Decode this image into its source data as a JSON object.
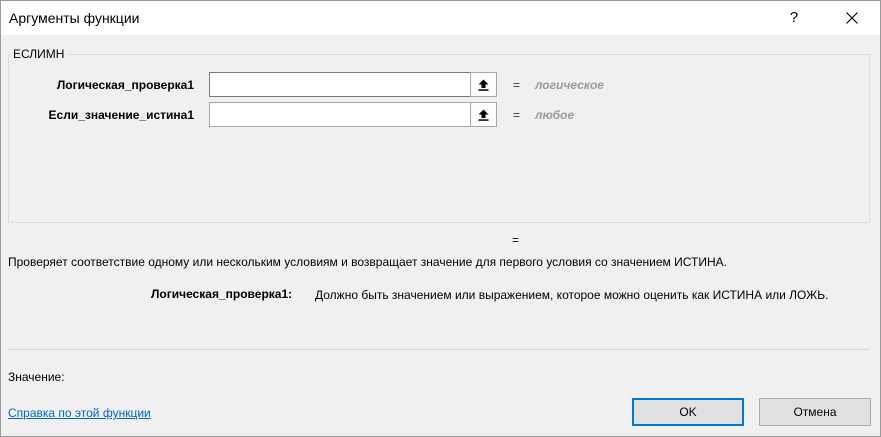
{
  "window": {
    "title": "Аргументы функции",
    "help_glyph": "?"
  },
  "function": {
    "name": "ЕСЛИМН",
    "args": [
      {
        "label": "Логическая_проверка1",
        "value": "",
        "hint": "логическое"
      },
      {
        "label": "Если_значение_истина1",
        "value": "",
        "hint": "любое"
      }
    ],
    "eq": "=",
    "result_eq": "=",
    "description": "Проверяет соответствие одному или нескольким условиям и возвращает значение для первого условия со значением ИСТИНА.",
    "arg_desc_label": "Логическая_проверка1:",
    "arg_desc_text": "Должно быть значением или выражением, которое можно оценить как ИСТИНА или ЛОЖЬ."
  },
  "footer": {
    "value_label": "Значение:",
    "help_link": "Справка по этой функции",
    "ok_label": "OK",
    "cancel_label": "Отмена"
  },
  "colors": {
    "accent": "#0078d7",
    "link": "#0066cc",
    "hint": "#9a9a9a"
  },
  "icons": {
    "ref_button": "collapse-dialog-arrow-up-icon",
    "close": "close-icon"
  }
}
